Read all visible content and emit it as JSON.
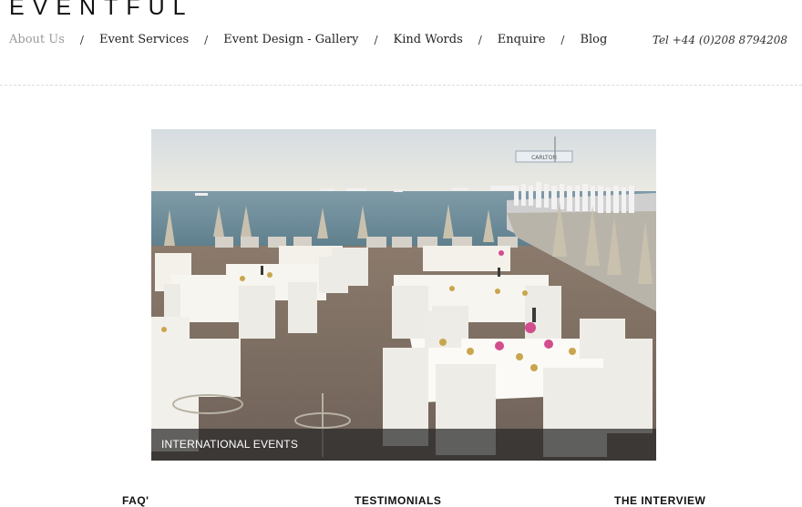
{
  "brand": {
    "logo_text": "EVENTFUL"
  },
  "nav": {
    "items": [
      {
        "label": "About Us",
        "active": true
      },
      {
        "label": "Event Services"
      },
      {
        "label": "Event Design - Gallery"
      },
      {
        "label": "Kind Words"
      },
      {
        "label": "Enquire"
      },
      {
        "label": "Blog"
      }
    ],
    "separator": "/"
  },
  "contact": {
    "phone": "Tel +44 (0)208 8794208"
  },
  "hero": {
    "caption": "INTERNATIONAL EVENTS",
    "sign_text": "CARLTON"
  },
  "footer": {
    "headings": [
      "FAQ'",
      "TESTIMONIALS",
      "THE INTERVIEW"
    ]
  },
  "colors": {
    "active_nav": "#9a9a9a",
    "text": "#222222",
    "caption_bg": "#282828"
  }
}
